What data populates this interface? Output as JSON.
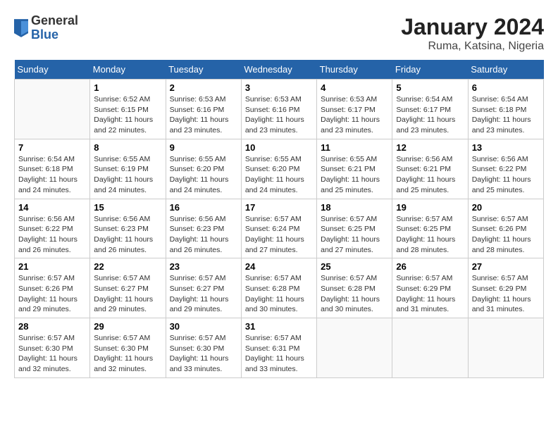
{
  "header": {
    "logo_general": "General",
    "logo_blue": "Blue",
    "month_title": "January 2024",
    "location": "Ruma, Katsina, Nigeria"
  },
  "days_of_week": [
    "Sunday",
    "Monday",
    "Tuesday",
    "Wednesday",
    "Thursday",
    "Friday",
    "Saturday"
  ],
  "weeks": [
    [
      {
        "day": "",
        "info": ""
      },
      {
        "day": "1",
        "info": "Sunrise: 6:52 AM\nSunset: 6:15 PM\nDaylight: 11 hours\nand 22 minutes."
      },
      {
        "day": "2",
        "info": "Sunrise: 6:53 AM\nSunset: 6:16 PM\nDaylight: 11 hours\nand 23 minutes."
      },
      {
        "day": "3",
        "info": "Sunrise: 6:53 AM\nSunset: 6:16 PM\nDaylight: 11 hours\nand 23 minutes."
      },
      {
        "day": "4",
        "info": "Sunrise: 6:53 AM\nSunset: 6:17 PM\nDaylight: 11 hours\nand 23 minutes."
      },
      {
        "day": "5",
        "info": "Sunrise: 6:54 AM\nSunset: 6:17 PM\nDaylight: 11 hours\nand 23 minutes."
      },
      {
        "day": "6",
        "info": "Sunrise: 6:54 AM\nSunset: 6:18 PM\nDaylight: 11 hours\nand 23 minutes."
      }
    ],
    [
      {
        "day": "7",
        "info": "Sunrise: 6:54 AM\nSunset: 6:18 PM\nDaylight: 11 hours\nand 24 minutes."
      },
      {
        "day": "8",
        "info": "Sunrise: 6:55 AM\nSunset: 6:19 PM\nDaylight: 11 hours\nand 24 minutes."
      },
      {
        "day": "9",
        "info": "Sunrise: 6:55 AM\nSunset: 6:20 PM\nDaylight: 11 hours\nand 24 minutes."
      },
      {
        "day": "10",
        "info": "Sunrise: 6:55 AM\nSunset: 6:20 PM\nDaylight: 11 hours\nand 24 minutes."
      },
      {
        "day": "11",
        "info": "Sunrise: 6:55 AM\nSunset: 6:21 PM\nDaylight: 11 hours\nand 25 minutes."
      },
      {
        "day": "12",
        "info": "Sunrise: 6:56 AM\nSunset: 6:21 PM\nDaylight: 11 hours\nand 25 minutes."
      },
      {
        "day": "13",
        "info": "Sunrise: 6:56 AM\nSunset: 6:22 PM\nDaylight: 11 hours\nand 25 minutes."
      }
    ],
    [
      {
        "day": "14",
        "info": "Sunrise: 6:56 AM\nSunset: 6:22 PM\nDaylight: 11 hours\nand 26 minutes."
      },
      {
        "day": "15",
        "info": "Sunrise: 6:56 AM\nSunset: 6:23 PM\nDaylight: 11 hours\nand 26 minutes."
      },
      {
        "day": "16",
        "info": "Sunrise: 6:56 AM\nSunset: 6:23 PM\nDaylight: 11 hours\nand 26 minutes."
      },
      {
        "day": "17",
        "info": "Sunrise: 6:57 AM\nSunset: 6:24 PM\nDaylight: 11 hours\nand 27 minutes."
      },
      {
        "day": "18",
        "info": "Sunrise: 6:57 AM\nSunset: 6:25 PM\nDaylight: 11 hours\nand 27 minutes."
      },
      {
        "day": "19",
        "info": "Sunrise: 6:57 AM\nSunset: 6:25 PM\nDaylight: 11 hours\nand 28 minutes."
      },
      {
        "day": "20",
        "info": "Sunrise: 6:57 AM\nSunset: 6:26 PM\nDaylight: 11 hours\nand 28 minutes."
      }
    ],
    [
      {
        "day": "21",
        "info": "Sunrise: 6:57 AM\nSunset: 6:26 PM\nDaylight: 11 hours\nand 29 minutes."
      },
      {
        "day": "22",
        "info": "Sunrise: 6:57 AM\nSunset: 6:27 PM\nDaylight: 11 hours\nand 29 minutes."
      },
      {
        "day": "23",
        "info": "Sunrise: 6:57 AM\nSunset: 6:27 PM\nDaylight: 11 hours\nand 29 minutes."
      },
      {
        "day": "24",
        "info": "Sunrise: 6:57 AM\nSunset: 6:28 PM\nDaylight: 11 hours\nand 30 minutes."
      },
      {
        "day": "25",
        "info": "Sunrise: 6:57 AM\nSunset: 6:28 PM\nDaylight: 11 hours\nand 30 minutes."
      },
      {
        "day": "26",
        "info": "Sunrise: 6:57 AM\nSunset: 6:29 PM\nDaylight: 11 hours\nand 31 minutes."
      },
      {
        "day": "27",
        "info": "Sunrise: 6:57 AM\nSunset: 6:29 PM\nDaylight: 11 hours\nand 31 minutes."
      }
    ],
    [
      {
        "day": "28",
        "info": "Sunrise: 6:57 AM\nSunset: 6:30 PM\nDaylight: 11 hours\nand 32 minutes."
      },
      {
        "day": "29",
        "info": "Sunrise: 6:57 AM\nSunset: 6:30 PM\nDaylight: 11 hours\nand 32 minutes."
      },
      {
        "day": "30",
        "info": "Sunrise: 6:57 AM\nSunset: 6:30 PM\nDaylight: 11 hours\nand 33 minutes."
      },
      {
        "day": "31",
        "info": "Sunrise: 6:57 AM\nSunset: 6:31 PM\nDaylight: 11 hours\nand 33 minutes."
      },
      {
        "day": "",
        "info": ""
      },
      {
        "day": "",
        "info": ""
      },
      {
        "day": "",
        "info": ""
      }
    ]
  ]
}
